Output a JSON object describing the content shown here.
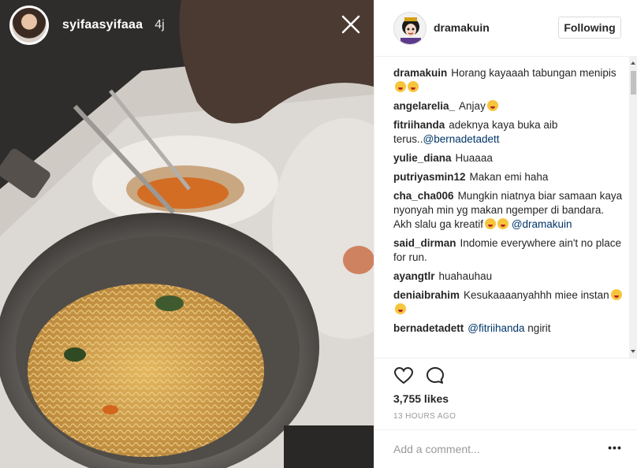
{
  "story": {
    "username": "syifaasyifaaa",
    "time": "4j"
  },
  "post": {
    "author": "dramakuin",
    "follow_label": "Following",
    "comments": [
      {
        "user": "dramakuin",
        "text": "Horang kayaaah tabungan menipis",
        "emoji_count": 2
      },
      {
        "user": "angelarelia_",
        "text": "Anjay",
        "emoji_count": 1
      },
      {
        "user": "fitriihanda",
        "text": "adeknya kaya buka aib terus..",
        "mention": "@bernadetadett",
        "emoji_count": 0
      },
      {
        "user": "yulie_diana",
        "text": "Huaaaa",
        "emoji_count": 0
      },
      {
        "user": "putriyasmin12",
        "text": "Makan emi haha",
        "emoji_count": 0
      },
      {
        "user": "cha_cha006",
        "text": "Mungkin niatnya biar samaan kaya nyonyah min yg makan ngemper di bandara. Akh slalu ga kreatif",
        "mention_after": "@dramakuin",
        "emoji_count": 2
      },
      {
        "user": "said_dirman",
        "text": "Indomie everywhere ain't no place for run.",
        "emoji_count": 0
      },
      {
        "user": "ayangtlr",
        "text": "huahauhau",
        "emoji_count": 0
      },
      {
        "user": "deniaibrahim",
        "text": "Kesukaaaanyahhh miee instan",
        "emoji_count": 2
      },
      {
        "user": "bernadetadett",
        "mention_first": "@fitriihanda",
        "text": "ngirit",
        "emoji_count": 0
      }
    ],
    "likes": "3,755 likes",
    "timestamp": "13 HOURS AGO",
    "comment_placeholder": "Add a comment...",
    "more_label": "•••"
  },
  "icons": {
    "close": "close-icon",
    "like": "heart-icon",
    "comment": "speech-bubble-icon",
    "more": "more-options-icon"
  },
  "colors": {
    "mention": "#003569",
    "border": "#efefef",
    "muted": "#999999"
  }
}
